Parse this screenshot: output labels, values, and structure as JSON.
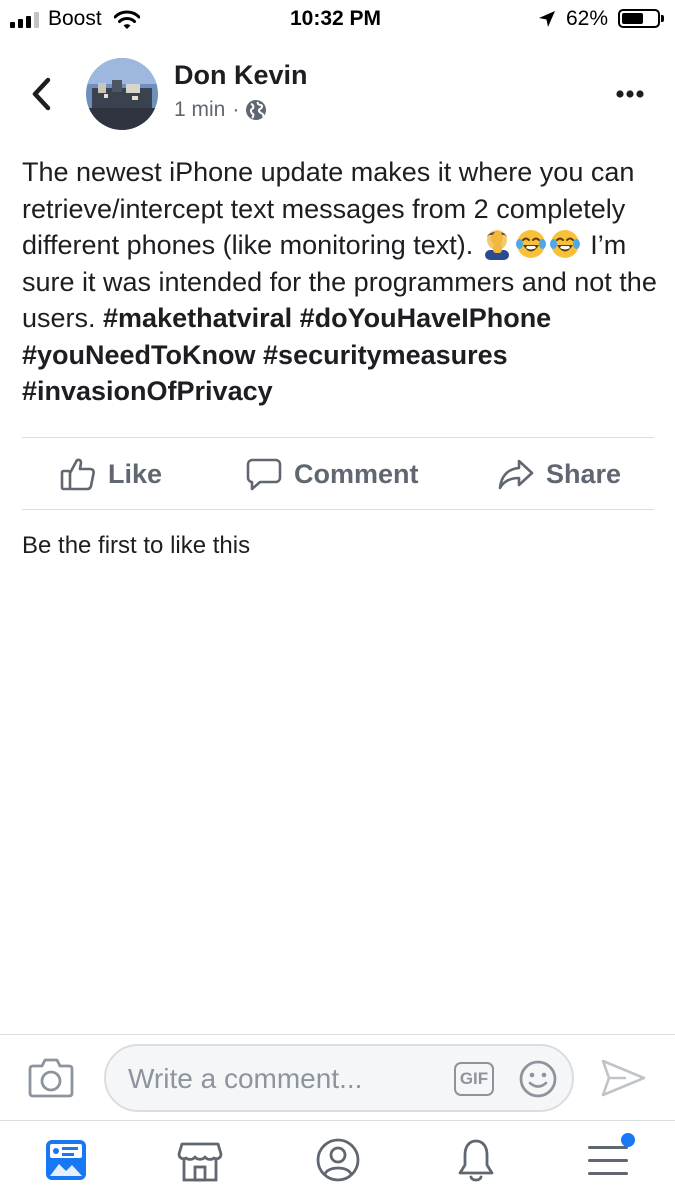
{
  "status_bar": {
    "carrier": "Boost",
    "time": "10:32 PM",
    "battery": "62%",
    "battery_level": 0.62
  },
  "post": {
    "author": "Don Kevin",
    "time_ago": "1 min",
    "separator": "·",
    "audience_icon": "globe-icon",
    "text_main": "The newest iPhone update makes it where you can retrieve/intercept text messages from 2 completely different phones (like monitoring text). ",
    "emojis": [
      "man-facepalming-emoji",
      "tears-of-joy-emoji",
      "tears-of-joy-emoji"
    ],
    "text_after_emoji": " I’m sure it was intended for the programmers and not the users. ",
    "hashtags": [
      "#makethatviral",
      "#doYouHaveIPhone",
      "#youNeedToKnow",
      "#securitymeasures",
      "#invasionOfPrivacy"
    ]
  },
  "actions": {
    "like": "Like",
    "comment": "Comment",
    "share": "Share"
  },
  "reactions_summary": "Be the first to like this",
  "composer": {
    "placeholder": "Write a comment...",
    "gif_label": "GIF"
  },
  "tab_bar": {
    "items": [
      "news-feed-icon",
      "marketplace-icon",
      "profile-icon",
      "notifications-icon",
      "menu-icon"
    ],
    "menu_has_badge": true
  },
  "colors": {
    "active_tab": "#1877f2",
    "secondary_text": "#606770",
    "icon_gray": "#8d949e",
    "divider": "#dadde1"
  }
}
